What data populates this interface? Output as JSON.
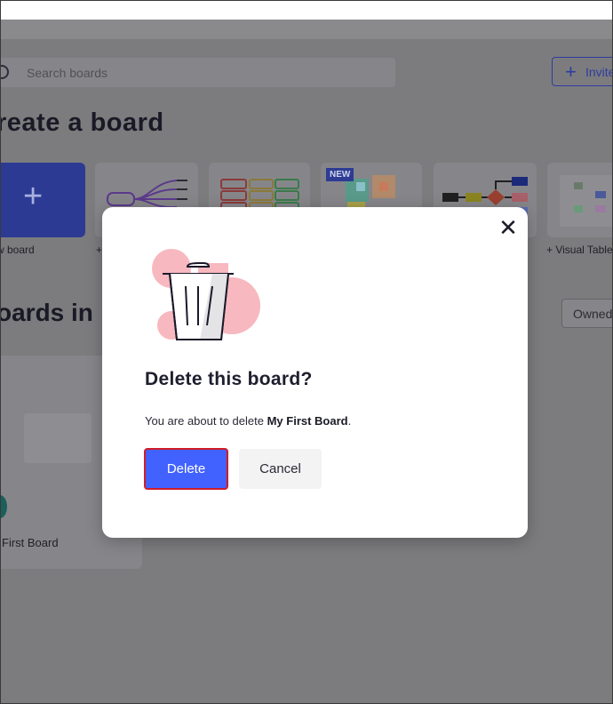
{
  "search": {
    "placeholder": "Search boards"
  },
  "header": {
    "invite_label": "Invite"
  },
  "create": {
    "title": "reate a board",
    "new_board_label": "w board",
    "template_label_visual_table": "+ Visual Table",
    "template_label_plus": "+",
    "new_badge": "NEW"
  },
  "boards": {
    "title": "oards in",
    "filter_label": "Owned",
    "items": [
      {
        "name": "First Board"
      }
    ]
  },
  "modal": {
    "title": "Delete this board?",
    "message_prefix": "You are about to delete ",
    "board_name": "My First Board",
    "message_suffix": ".",
    "delete_label": "Delete",
    "cancel_label": "Cancel",
    "close_icon": "close-icon"
  },
  "colors": {
    "accent": "#4262ff",
    "danger_outline": "#d01c2a",
    "overlay": "#7c7c7e",
    "trash_blob": "#f7b8bf"
  }
}
